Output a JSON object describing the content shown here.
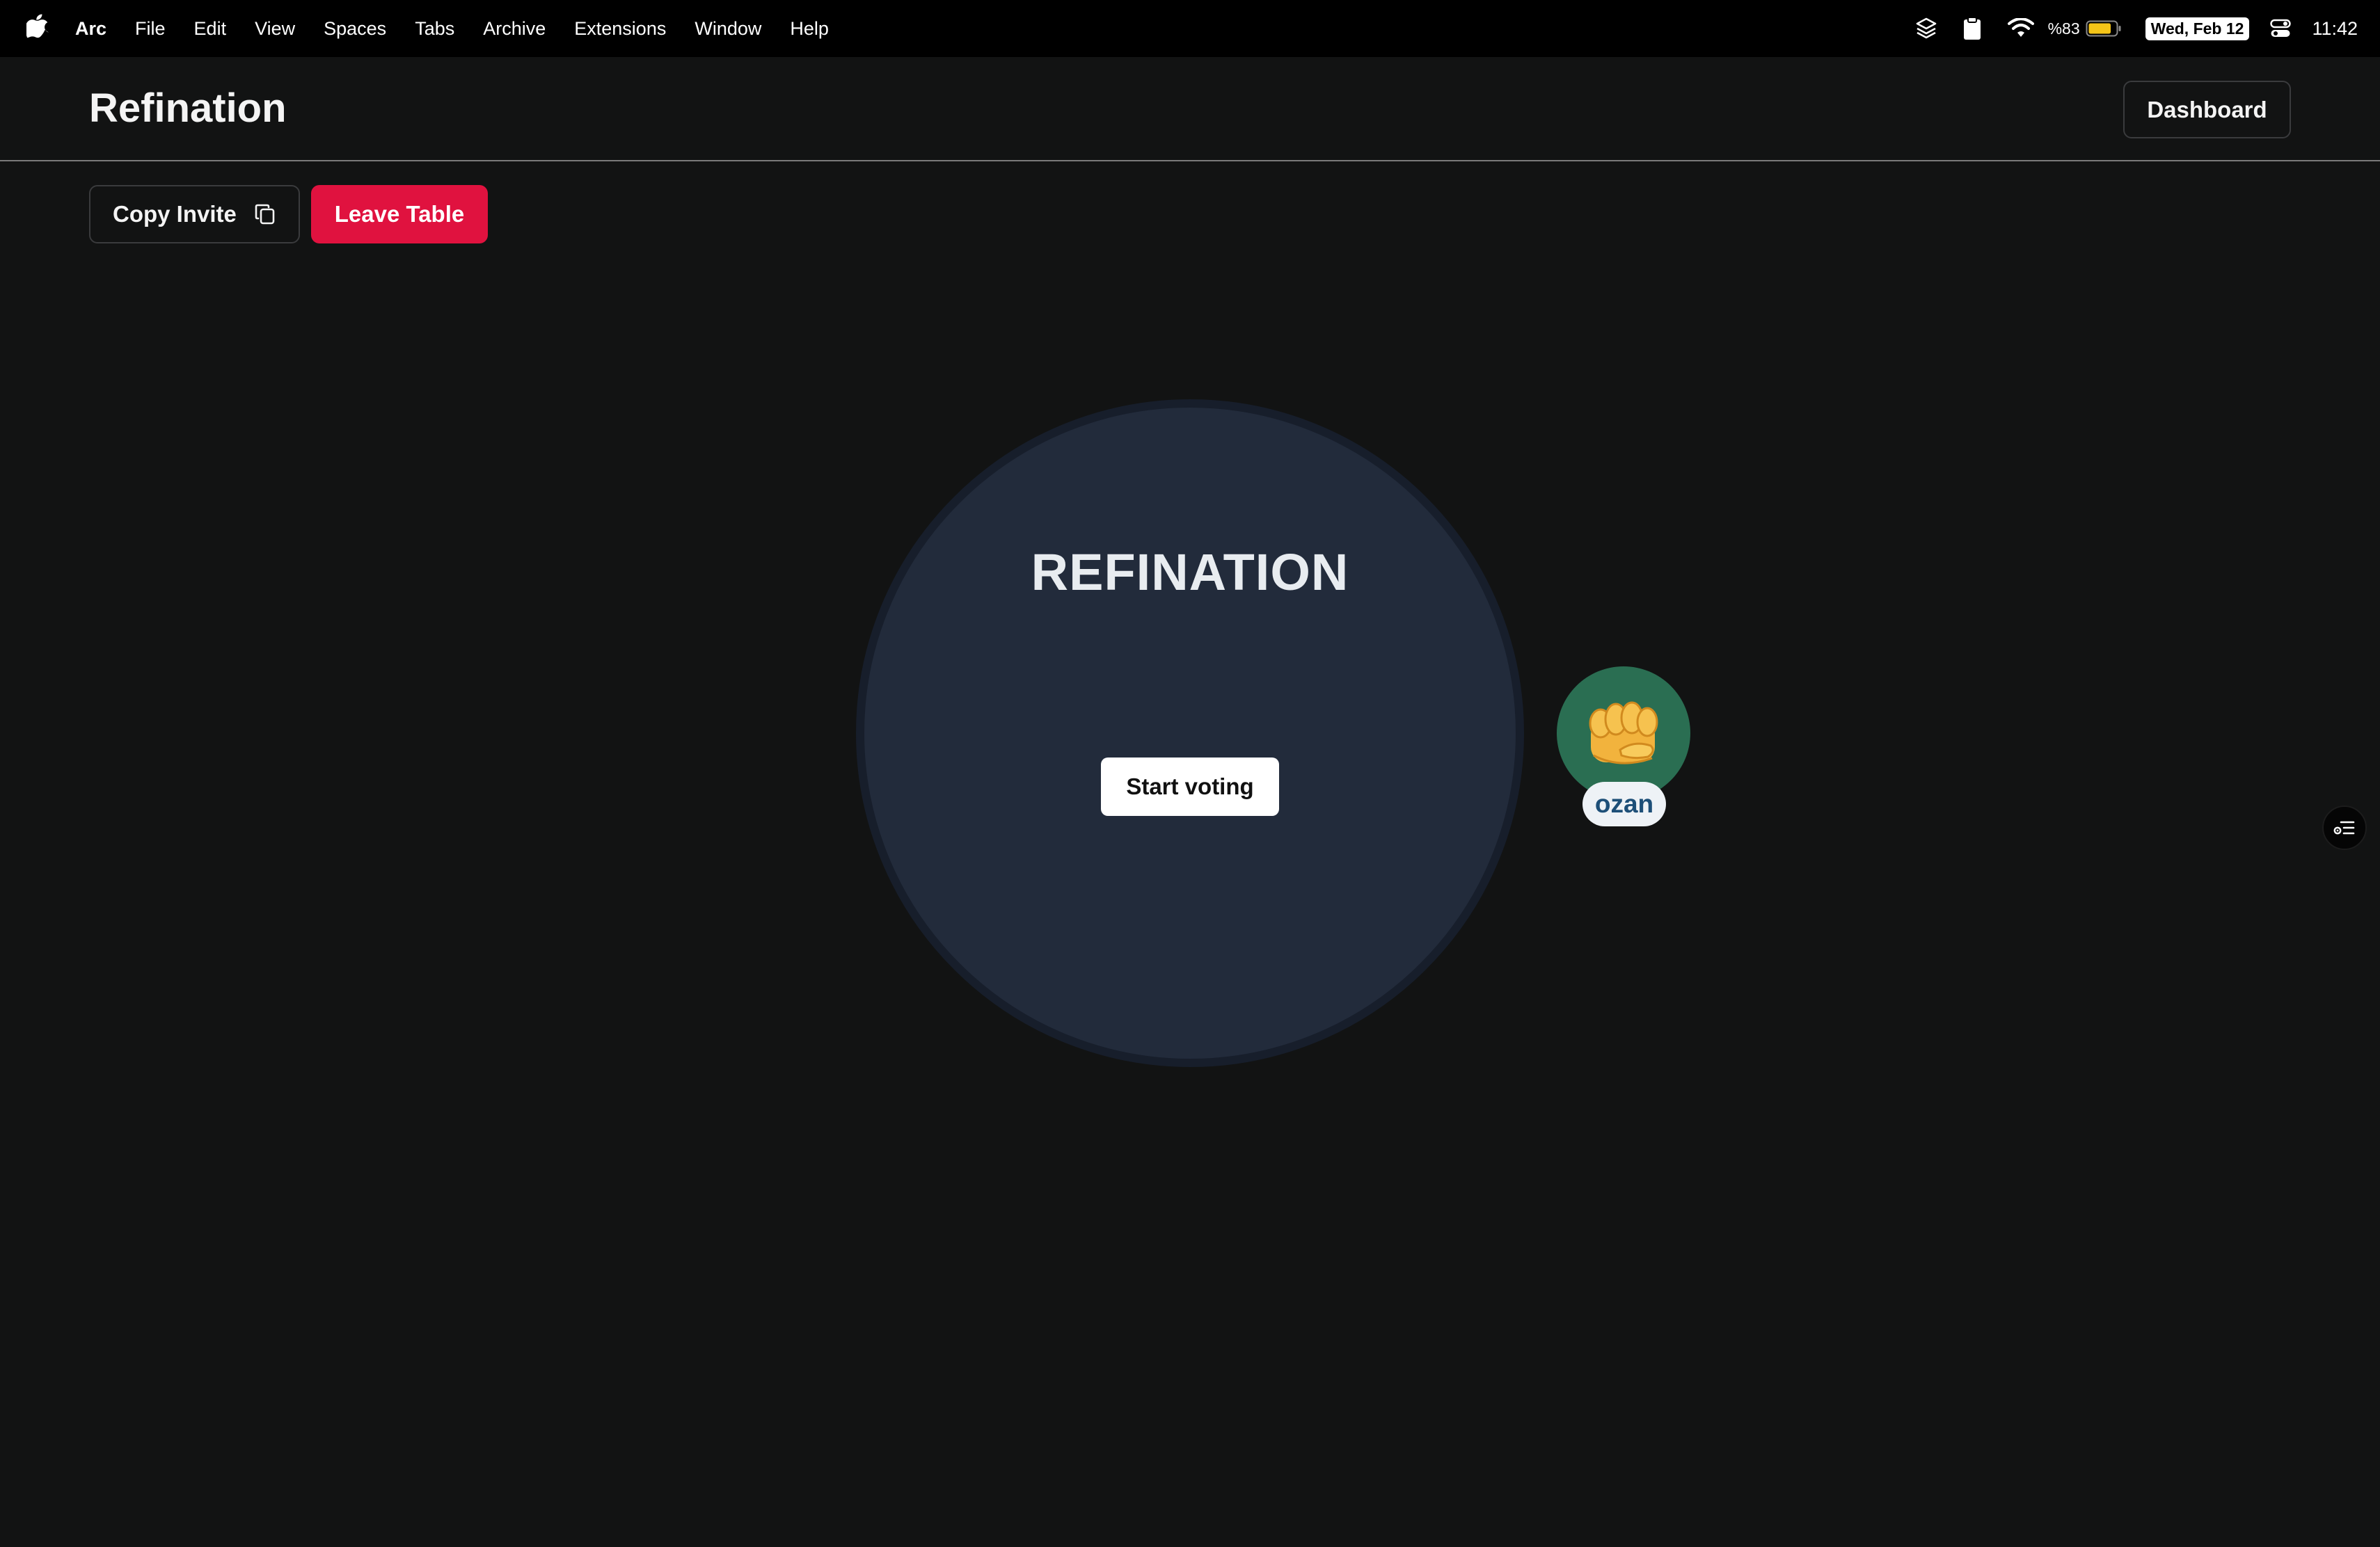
{
  "menubar": {
    "apple_icon": "apple-logo-icon",
    "items": [
      {
        "label": "Arc",
        "app": true
      },
      {
        "label": "File"
      },
      {
        "label": "Edit"
      },
      {
        "label": "View"
      },
      {
        "label": "Spaces"
      },
      {
        "label": "Tabs"
      },
      {
        "label": "Archive"
      },
      {
        "label": "Extensions"
      },
      {
        "label": "Window"
      },
      {
        "label": "Help"
      }
    ],
    "status": {
      "icons": [
        "layers-icon",
        "clipboard-icon",
        "wifi-icon",
        "battery-icon",
        "control-center-icon"
      ],
      "battery_percent": "%83",
      "battery_level": 0.83,
      "date": "Wed, Feb 12",
      "time": "11:42"
    }
  },
  "header": {
    "title": "Refination",
    "dashboard_label": "Dashboard"
  },
  "toolbar": {
    "copy_invite_label": "Copy Invite",
    "copy_icon": "copy-icon",
    "leave_table_label": "Leave Table"
  },
  "table": {
    "title": "REFINATION",
    "start_voting_label": "Start voting"
  },
  "participants": [
    {
      "name": "ozan",
      "emoji": "👊",
      "avatar_color": "#2a6e52"
    }
  ],
  "side_button": {
    "icon": "list-settings-icon"
  },
  "colors": {
    "background": "#121313",
    "menubar": "#000000",
    "danger": "#e0123f",
    "table": "#222b3b",
    "avatar": "#2a6e52",
    "name_text": "#1d4f78"
  }
}
